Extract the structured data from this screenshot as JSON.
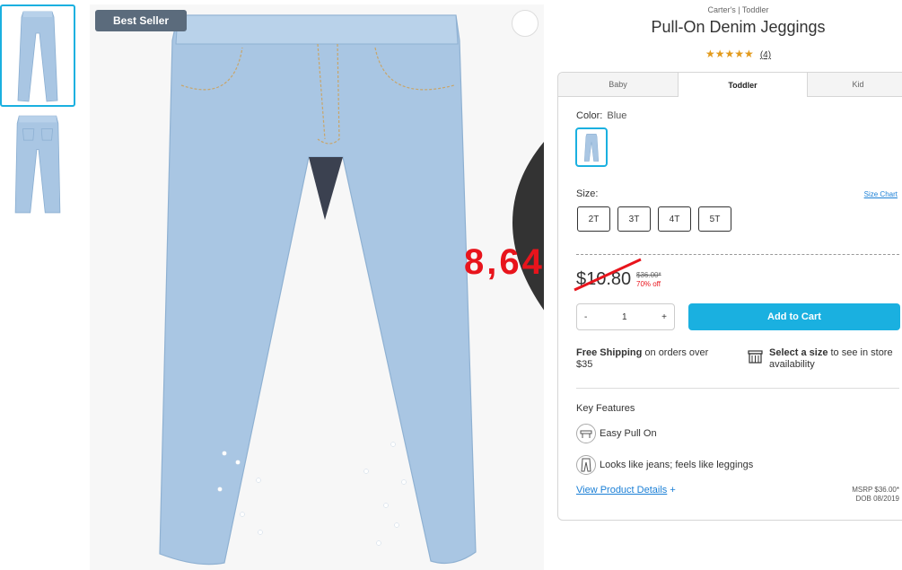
{
  "gallery": {
    "thumbnails": [
      "front-view",
      "back-view"
    ],
    "badge": "Best Seller",
    "favorite_icon": "heart-icon"
  },
  "overlay_price": "8,64",
  "product": {
    "brand_line": "Carter's | Toddler",
    "title": "Pull-On Denim Jeggings",
    "stars": "★★★★★",
    "rating": 5,
    "review_count": "(4)"
  },
  "tabs": [
    {
      "label": "Baby",
      "active": false
    },
    {
      "label": "Toddler",
      "active": true
    },
    {
      "label": "Kid",
      "active": false
    }
  ],
  "color": {
    "label": "Color:",
    "value": "Blue"
  },
  "size": {
    "label": "Size:",
    "chart_link": "Size Chart",
    "options": [
      "2T",
      "3T",
      "4T",
      "5T"
    ]
  },
  "price": {
    "current": "$10.80",
    "original": "$36.00*",
    "discount": "70% off"
  },
  "quantity": {
    "minus": "-",
    "value": "1",
    "plus": "+"
  },
  "add_to_cart": "Add to Cart",
  "shipping": {
    "bold": "Free Shipping",
    "rest": " on orders over $35"
  },
  "store": {
    "bold": "Select a size",
    "rest": " to see in store availability"
  },
  "key_features": {
    "title": "Key Features",
    "items": [
      "Easy Pull On",
      "Looks like jeans; feels like leggings"
    ]
  },
  "view_details": {
    "label": "View Product Details",
    "plus": "+"
  },
  "msrp": {
    "line1": "MSRP $36.00*",
    "line2": "DOB 08/2019"
  },
  "colors": {
    "accent": "#1ab0e0",
    "denim": "#a9c6e3",
    "star": "#e29a1c",
    "sale_red": "#e8141c",
    "link": "#1a7fd6",
    "badge_bg": "#5b6b7c"
  }
}
